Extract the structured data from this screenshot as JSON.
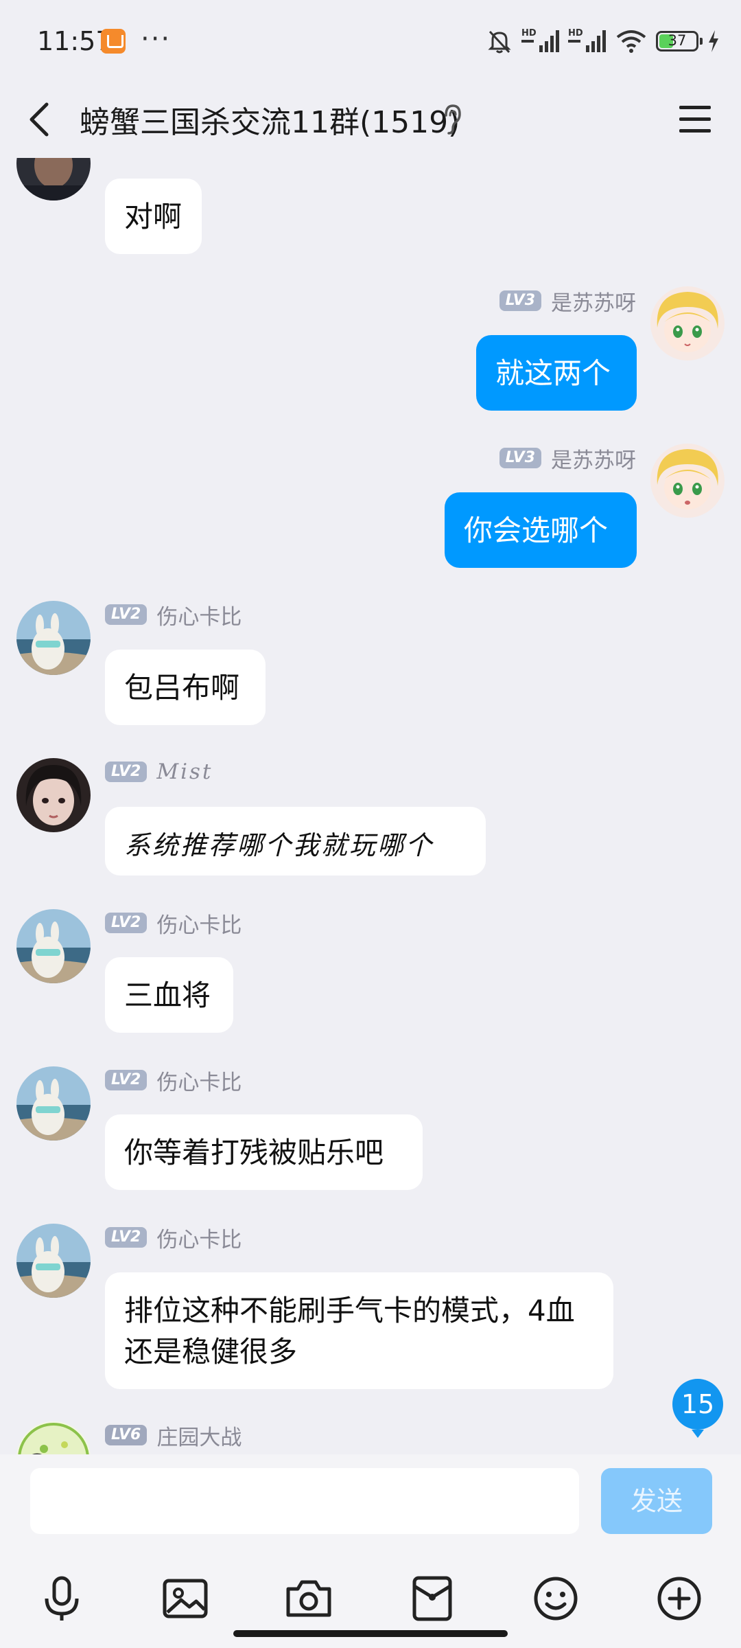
{
  "status_bar": {
    "time": "11:57",
    "dots": "···",
    "battery": "37",
    "net1": "HD",
    "net2": "HD"
  },
  "header": {
    "title": "螃蟹三国杀交流11群(1519)"
  },
  "messages": [
    {
      "sender": "",
      "level": "",
      "text": "对啊",
      "side": "left"
    },
    {
      "sender": "是苏苏呀",
      "level": "LV3",
      "text": "就这两个",
      "side": "right"
    },
    {
      "sender": "是苏苏呀",
      "level": "LV3",
      "text": "你会选哪个",
      "side": "right"
    },
    {
      "sender": "伤心卡比",
      "level": "LV2",
      "text": "包吕布啊",
      "side": "left"
    },
    {
      "sender": "Mist",
      "level": "LV2",
      "text": "系统推荐哪个我就玩哪个",
      "side": "left"
    },
    {
      "sender": "伤心卡比",
      "level": "LV2",
      "text": "三血将",
      "side": "left"
    },
    {
      "sender": "伤心卡比",
      "level": "LV2",
      "text": "你等着打残被贴乐吧",
      "side": "left"
    },
    {
      "sender": "伤心卡比",
      "level": "LV2",
      "text": "排位这种不能刷手气卡的模式，4血还是稳健很多",
      "side": "left"
    },
    {
      "sender": "庄园大战",
      "level": "LV6",
      "text": "",
      "side": "left"
    }
  ],
  "unread_count": "15",
  "input": {
    "value": "",
    "send_label": "发送"
  },
  "toolbar": [
    "mic-icon",
    "image-icon",
    "camera-icon",
    "red-packet-icon",
    "emoji-icon",
    "plus-icon"
  ],
  "colors": {
    "background": "#efeff4",
    "my_bubble": "#0099ff",
    "other_bubble": "#ffffff",
    "send_button": "#85c8fb",
    "badge": "#1296f0"
  }
}
